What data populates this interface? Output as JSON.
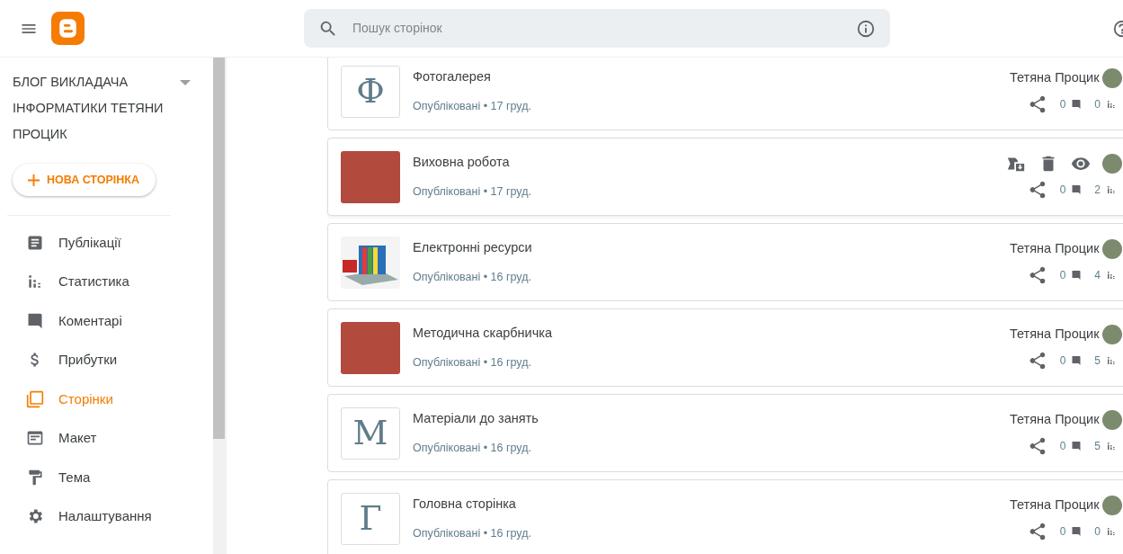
{
  "header": {
    "search": {
      "placeholder": "Пошук сторінок"
    }
  },
  "sidebar": {
    "blog_title": "БЛОГ ВИКЛАДАЧА ІНФОРМАТИКИ ТЕТЯНИ ПРОЦИК",
    "new_button": "НОВА СТОРІНКА",
    "items": [
      {
        "label": "Публікації",
        "selected": false
      },
      {
        "label": "Статистика",
        "selected": false
      },
      {
        "label": "Коментарі",
        "selected": false
      },
      {
        "label": "Прибутки",
        "selected": false
      },
      {
        "label": "Сторінки",
        "selected": true
      },
      {
        "label": "Макет",
        "selected": false
      },
      {
        "label": "Тема",
        "selected": false
      },
      {
        "label": "Налаштування",
        "selected": false
      }
    ]
  },
  "pages": [
    {
      "title": "Фотогалерея",
      "meta": "Опубліковані • 17 груд.",
      "thumb": {
        "kind": "letter",
        "letter": "Ф"
      },
      "hovered": false,
      "author": "Тетяна Процик",
      "comments": "0",
      "views": "0"
    },
    {
      "title": "Виховна робота",
      "meta": "Опубліковані • 17 груд.",
      "thumb": {
        "kind": "photo"
      },
      "hovered": true,
      "comments": "0",
      "views": "2"
    },
    {
      "title": "Електронні ресурси",
      "meta": "Опубліковані • 16 груд.",
      "thumb": {
        "kind": "books"
      },
      "hovered": false,
      "author": "Тетяна Процик",
      "comments": "0",
      "views": "4"
    },
    {
      "title": "Методична скарбничка",
      "meta": "Опубліковані • 16 груд.",
      "thumb": {
        "kind": "photo"
      },
      "hovered": false,
      "author": "Тетяна Процик",
      "comments": "0",
      "views": "5"
    },
    {
      "title": "Матеріали до занять",
      "meta": "Опубліковані • 16 груд.",
      "thumb": {
        "kind": "letter",
        "letter": "М"
      },
      "hovered": false,
      "author": "Тетяна Процик",
      "comments": "0",
      "views": "5"
    },
    {
      "title": "Головна сторінка",
      "meta": "Опубліковані • 16 груд.",
      "thumb": {
        "kind": "letter",
        "letter": "Г"
      },
      "hovered": false,
      "author": "Тетяна Процик",
      "comments": "0",
      "views": "0"
    }
  ]
}
